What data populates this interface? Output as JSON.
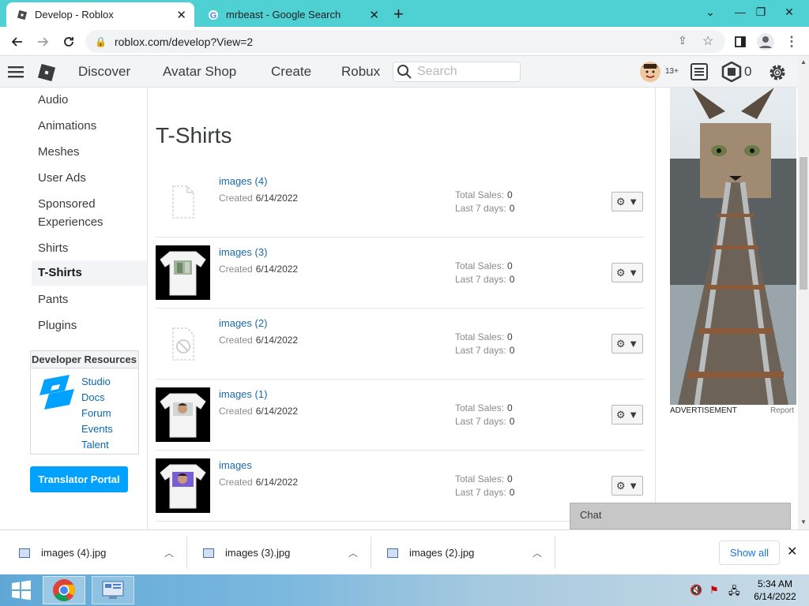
{
  "browser": {
    "tabs": [
      {
        "title": "Develop - Roblox",
        "active": true
      },
      {
        "title": "mrbeast - Google Search",
        "active": false
      }
    ],
    "new_tab": "+",
    "url": "roblox.com/develop?View=2"
  },
  "header": {
    "nav": [
      "Discover",
      "Avatar Shop",
      "Create",
      "Robux"
    ],
    "search_placeholder": "Search",
    "age_badge": "13+",
    "robux_count": "0"
  },
  "sidebar": {
    "items": [
      "Audio",
      "Animations",
      "Meshes",
      "User Ads",
      "Sponsored Experiences",
      "Shirts",
      "T-Shirts",
      "Pants",
      "Plugins"
    ],
    "active": "T-Shirts",
    "dev_resources": {
      "title": "Developer Resources",
      "links": [
        "Studio",
        "Docs",
        "Forum",
        "Events",
        "Talent"
      ]
    },
    "translator_button": "Translator Portal"
  },
  "main": {
    "title": "T-Shirts",
    "items": [
      {
        "name": "images (4)",
        "created_label": "Created",
        "created": "6/14/2022",
        "total_sales_label": "Total Sales:",
        "total_sales": "0",
        "last7_label": "Last 7 days:",
        "last7": "0",
        "thumb": "placeholder"
      },
      {
        "name": "images (3)",
        "created_label": "Created",
        "created": "6/14/2022",
        "total_sales_label": "Total Sales:",
        "total_sales": "0",
        "last7_label": "Last 7 days:",
        "last7": "0",
        "thumb": "shirt-photo"
      },
      {
        "name": "images (2)",
        "created_label": "Created",
        "created": "6/14/2022",
        "total_sales_label": "Total Sales:",
        "total_sales": "0",
        "last7_label": "Last 7 days:",
        "last7": "0",
        "thumb": "blocked"
      },
      {
        "name": "images (1)",
        "created_label": "Created",
        "created": "6/14/2022",
        "total_sales_label": "Total Sales:",
        "total_sales": "0",
        "last7_label": "Last 7 days:",
        "last7": "0",
        "thumb": "shirt-face"
      },
      {
        "name": "images",
        "created_label": "Created",
        "created": "6/14/2022",
        "total_sales_label": "Total Sales:",
        "total_sales": "0",
        "last7_label": "Last 7 days:",
        "last7": "0",
        "thumb": "shirt-purple"
      }
    ]
  },
  "ad": {
    "label": "ADVERTISEMENT",
    "report": "Report"
  },
  "chat": {
    "label": "Chat"
  },
  "downloads": {
    "files": [
      "images (4).jpg",
      "images (3).jpg",
      "images (2).jpg"
    ],
    "show_all": "Show all"
  },
  "taskbar": {
    "time": "5:34 AM",
    "date": "6/14/2022"
  },
  "colors": {
    "tab_strip": "#4fd0d3",
    "accent_blue": "#00a2ff",
    "link_blue": "#1a6aa8"
  }
}
